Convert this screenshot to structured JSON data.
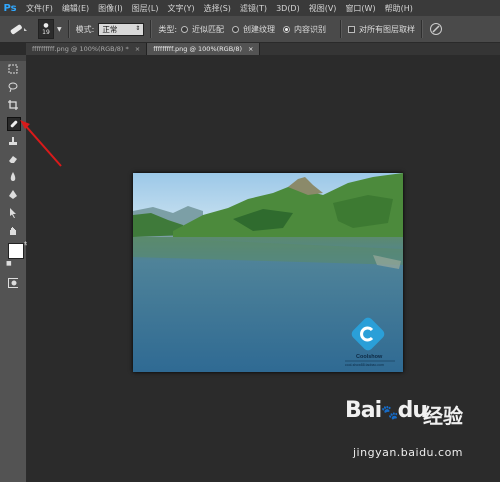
{
  "app": {
    "logo": "Ps"
  },
  "menu": [
    "文件(F)",
    "编辑(E)",
    "图像(I)",
    "图层(L)",
    "文字(Y)",
    "选择(S)",
    "滤镜(T)",
    "3D(D)",
    "视图(V)",
    "窗口(W)",
    "帮助(H)"
  ],
  "options": {
    "brush_size": "19",
    "mode_label": "模式:",
    "mode_value": "正常",
    "type_label": "类型:",
    "type_options": [
      {
        "label": "近似匹配",
        "selected": false
      },
      {
        "label": "创建纹理",
        "selected": false
      },
      {
        "label": "内容识别",
        "selected": true
      }
    ],
    "sample_all_layers": "对所有图层取样"
  },
  "tabs": [
    {
      "label": "ffffffffff.png @ 100%(RGB/8) *",
      "active": false
    },
    {
      "label": "fffffffff.png @ 100%(RGB/8)",
      "active": true
    }
  ],
  "photo": {
    "logo_brand": "Coolshow",
    "logo_url": "cool-show88.taobao.com"
  },
  "watermark": {
    "brand": "Bai",
    "paw": "du",
    "cn": "经验",
    "url": "jingyan.baidu.com"
  },
  "colors": {
    "panel": "#535353",
    "bg": "#2b2b2b",
    "arrow": "#d91a1a"
  }
}
